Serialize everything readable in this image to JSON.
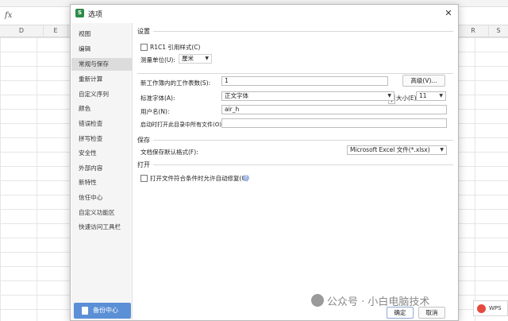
{
  "spreadsheet": {
    "fx_label": "fx",
    "columns": [
      "D",
      "E",
      "R",
      "S"
    ]
  },
  "dialog": {
    "app_icon_letter": "S",
    "title": "选项",
    "close_glyph": "✕"
  },
  "sidebar": {
    "items": [
      {
        "label": "视图"
      },
      {
        "label": "编辑"
      },
      {
        "label": "常规与保存",
        "active": true
      },
      {
        "label": "重新计算"
      },
      {
        "label": "自定义序列"
      },
      {
        "label": "颜色"
      },
      {
        "label": "错误检查"
      },
      {
        "label": "拼写检查"
      },
      {
        "label": "安全性"
      },
      {
        "label": "外部内容"
      },
      {
        "label": "新特性"
      },
      {
        "label": "信任中心"
      },
      {
        "label": "自定义功能区"
      },
      {
        "label": "快速访问工具栏"
      }
    ],
    "backup_label": "备份中心"
  },
  "settings": {
    "section_title": "设置",
    "r1c1_label": "R1C1 引用样式(C)",
    "unit_label": "测量单位(U):",
    "unit_value": "厘米",
    "sheets_label": "新工作簿内的工作表数(S):",
    "sheets_value": "1",
    "advanced_label": "高级(V)...",
    "font_label": "标准字体(A):",
    "font_value": "正文字体",
    "size_label": "大小(E):",
    "size_value": "11",
    "username_label": "用户名(N):",
    "username_value": "air_h",
    "startup_label": "启动时打开此目录中所有文件(O):",
    "startup_value": ""
  },
  "save": {
    "section_title": "保存",
    "format_label": "文档保存默认格式(F):",
    "format_value": "Microsoft Excel 文件(*.xlsx)"
  },
  "open": {
    "section_title": "打开",
    "repair_label": "打开文件符合条件时允许自动修复(Q)"
  },
  "footer": {
    "ok_label": "确定",
    "cancel_label": "取消"
  },
  "overlay": {
    "watermark_text": "公众号 · 小白电脑技术",
    "wps_text": "WPS"
  }
}
